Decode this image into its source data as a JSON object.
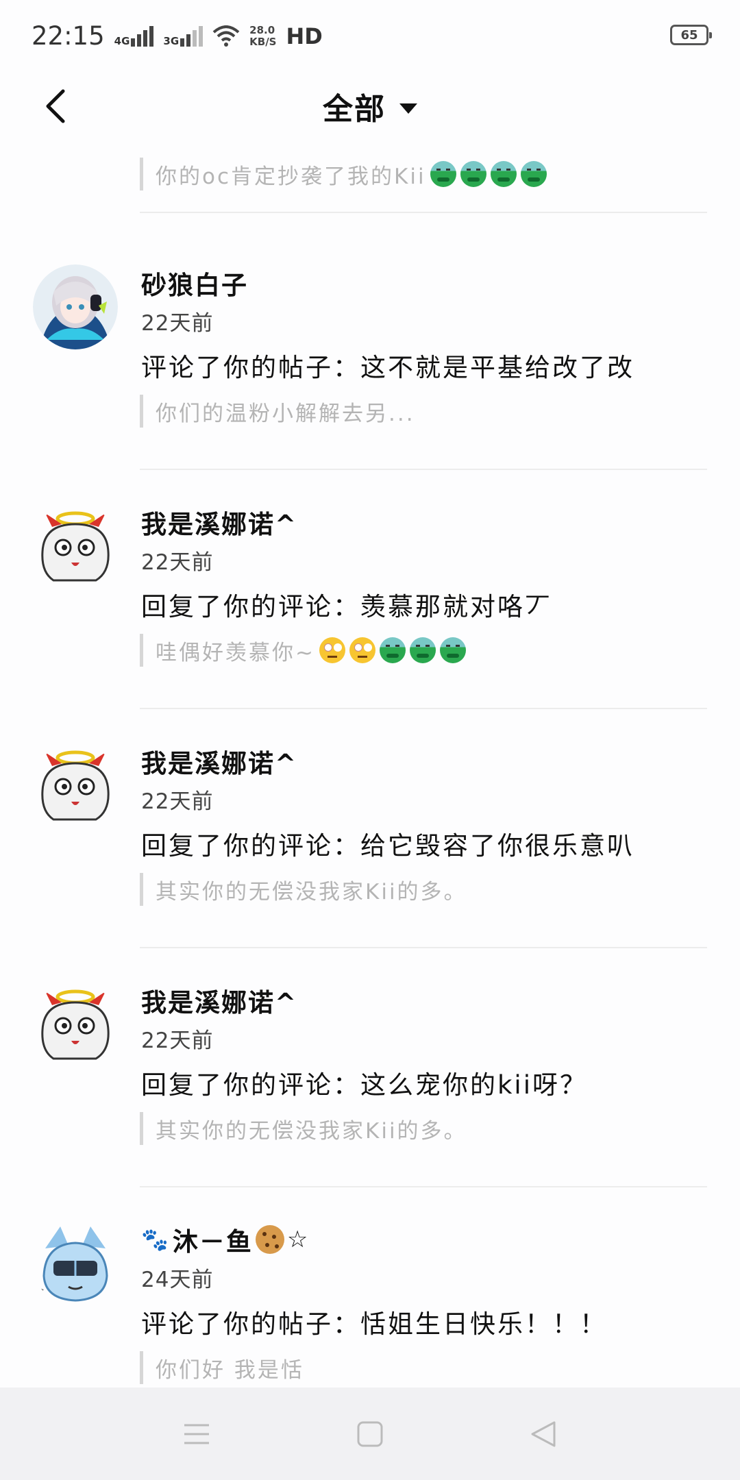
{
  "status_bar": {
    "time": "22:15",
    "net1": "4G",
    "net2": "3G",
    "speed_value": "28.0",
    "speed_unit": "KB/S",
    "hd": "HD",
    "battery": "65"
  },
  "header": {
    "title": "全部"
  },
  "top_quote": {
    "text": "你的oc肯定抄袭了我的Kii",
    "emojis": [
      "sick-emoji",
      "sick-emoji",
      "sick-emoji",
      "sick-emoji"
    ]
  },
  "notifications": [
    {
      "name": "砂狼白子",
      "time": "22天前",
      "content": "评论了你的帖子：这不就是平基给改了改",
      "quote": "你们的温粉小解解去另...",
      "avatar": "anime-girl-avatar"
    },
    {
      "name": "我是溪娜诺^",
      "time": "22天前",
      "content": "回复了你的评论：羡慕那就对咯丆",
      "quote": "哇偶好羡慕你~",
      "avatar": "halo-cat-avatar"
    },
    {
      "name": "我是溪娜诺^",
      "time": "22天前",
      "content": "回复了你的评论：给它毁容了你很乐意叭",
      "quote": "其实你的无偿没我家Kii的多。",
      "avatar": "halo-cat-avatar"
    },
    {
      "name": "我是溪娜诺^",
      "time": "22天前",
      "content": "回复了你的评论：这么宠你的kii呀？",
      "quote": "其实你的无偿没我家Kii的多。",
      "avatar": "halo-cat-avatar"
    },
    {
      "name": "沐－鱼",
      "name_suffix": "☆",
      "time": "24天前",
      "content": "评论了你的帖子：恬姐生日快乐！！！",
      "quote": "你们好 我是恬",
      "avatar": "blue-character-avatar"
    }
  ],
  "colors": {
    "background": "#fdfdfe",
    "quote_text": "#b4b4b4",
    "divider": "#ececec",
    "nav_bar": "#f1f1f3"
  }
}
